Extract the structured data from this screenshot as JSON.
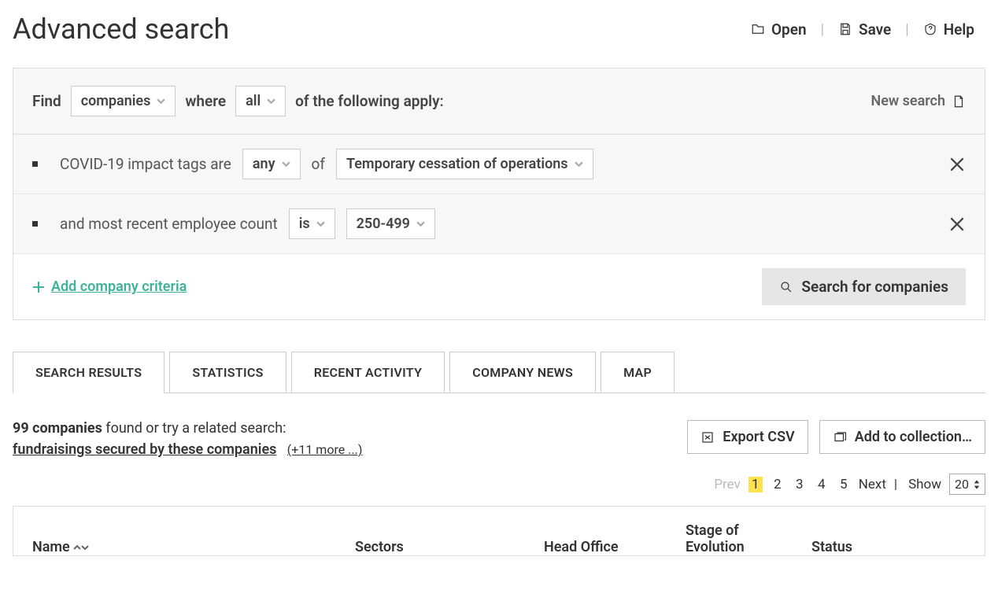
{
  "header": {
    "title": "Advanced search",
    "actions": {
      "open": "Open",
      "save": "Save",
      "help": "Help"
    }
  },
  "builder": {
    "find_label": "Find",
    "entity": "companies",
    "where_label": "where",
    "quantifier": "all",
    "apply_label": "of the following apply:",
    "new_search": "New search",
    "criteria": [
      {
        "label": "COVID-19 impact tags are",
        "op": "any",
        "of_label": "of",
        "value": "Temporary cessation of operations"
      },
      {
        "label": "and most recent employee count",
        "op": "is",
        "value": "250-499"
      }
    ],
    "add_criteria": "Add company criteria",
    "search_button": "Search for companies"
  },
  "tabs": [
    "SEARCH RESULTS",
    "STATISTICS",
    "RECENT ACTIVITY",
    "COMPANY NEWS",
    "MAP"
  ],
  "active_tab": 0,
  "results": {
    "count_text": "99 companies",
    "found_text": " found or try a related search:",
    "related_link": "fundraisings secured by these companies",
    "more_link": "(+11 more ...)",
    "export_csv": "Export CSV",
    "add_collection": "Add to collection…"
  },
  "pager": {
    "prev": "Prev",
    "pages": [
      "1",
      "2",
      "3",
      "4",
      "5"
    ],
    "active_page": "1",
    "next": "Next",
    "show_label": "Show",
    "show_value": "20"
  },
  "columns": {
    "name": "Name",
    "sectors": "Sectors",
    "head_office": "Head Office",
    "stage": "Stage of Evolution",
    "status": "Status"
  }
}
